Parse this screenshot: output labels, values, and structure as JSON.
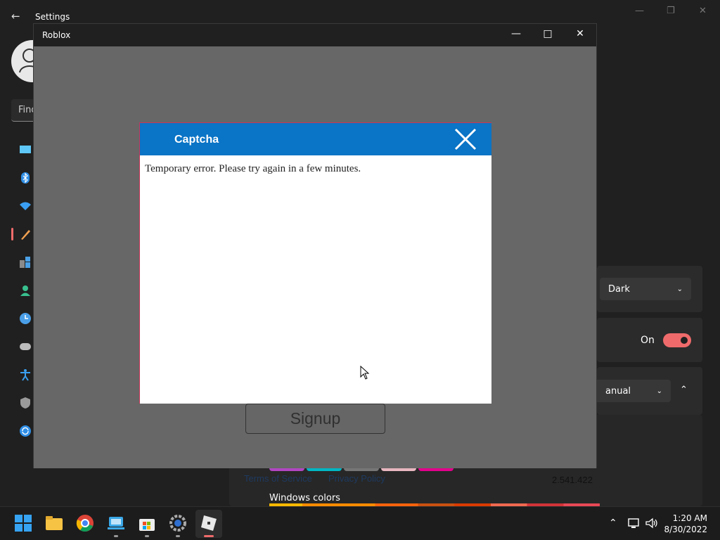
{
  "settings": {
    "title": "Settings",
    "search_placeholder": "Find",
    "theme_value": "Dark",
    "toggle_label": "On",
    "manual_value": "anual",
    "windows_colors_label": "Windows colors"
  },
  "roblox": {
    "window_title": "Roblox",
    "signup_label": "Signup",
    "terms_link": "Terms of Service",
    "privacy_link": "Privacy Policy",
    "version": "2.541.422"
  },
  "captcha": {
    "title": "Captcha",
    "message": "Temporary error. Please try again in a few minutes."
  },
  "taskbar": {
    "time": "1:20 AM",
    "date": "8/30/2022"
  },
  "colors": {
    "accent": "#ef6b6b",
    "captcha_header": "#0a74c6"
  }
}
